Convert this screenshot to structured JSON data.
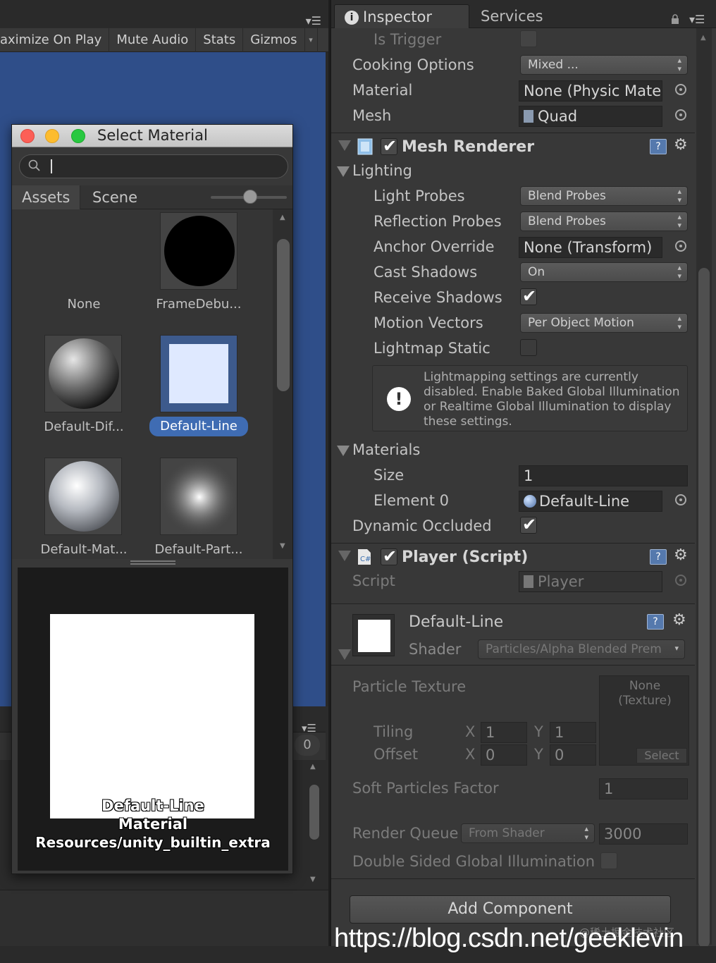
{
  "game_toolbar": {
    "buttons": [
      "aximize On Play",
      "Mute Audio",
      "Stats",
      "Gizmos"
    ]
  },
  "select_material": {
    "title": "Select Material",
    "search_value": "",
    "tabs": [
      "Assets",
      "Scene"
    ],
    "items": [
      {
        "label": "None",
        "icon": "none"
      },
      {
        "label": "FrameDebu...",
        "icon": "black-circle"
      },
      {
        "label": "Default-Dif...",
        "icon": "grey-sphere"
      },
      {
        "label": "Default-Line",
        "icon": "light-square",
        "selected": true
      },
      {
        "label": "Default-Mat...",
        "icon": "shiny-sphere"
      },
      {
        "label": "Default-Part...",
        "icon": "soft-glow"
      }
    ],
    "preview": {
      "name": "Default-Line",
      "type": "Material",
      "path": "Resources/unity_builtin_extra"
    }
  },
  "lower_panel": {
    "count": "0"
  },
  "inspector": {
    "tabs": [
      "Inspector",
      "Services"
    ],
    "collider": {
      "is_trigger": {
        "label": "Is Trigger",
        "checked": false
      },
      "cooking_options": {
        "label": "Cooking Options",
        "value": "Mixed ..."
      },
      "material": {
        "label": "Material",
        "value": "None (Physic Mate"
      },
      "mesh": {
        "label": "Mesh",
        "value": "Quad"
      }
    },
    "mesh_renderer": {
      "title": "Mesh Renderer",
      "enabled": true,
      "lighting_label": "Lighting",
      "light_probes": {
        "label": "Light Probes",
        "value": "Blend Probes"
      },
      "reflection_probes": {
        "label": "Reflection Probes",
        "value": "Blend Probes"
      },
      "anchor_override": {
        "label": "Anchor Override",
        "value": "None (Transform)"
      },
      "cast_shadows": {
        "label": "Cast Shadows",
        "value": "On"
      },
      "receive_shadows": {
        "label": "Receive Shadows",
        "checked": true
      },
      "motion_vectors": {
        "label": "Motion Vectors",
        "value": "Per Object Motion"
      },
      "lightmap_static": {
        "label": "Lightmap Static",
        "checked": false
      },
      "info": "Lightmapping settings are currently disabled. Enable Baked Global Illumination or Realtime Global Illumination to display these settings.",
      "materials_label": "Materials",
      "size": {
        "label": "Size",
        "value": "1"
      },
      "element0": {
        "label": "Element 0",
        "value": "Default-Line"
      },
      "dynamic_occluded": {
        "label": "Dynamic Occluded",
        "checked": true
      }
    },
    "player_script": {
      "title": "Player (Script)",
      "enabled": true,
      "script": {
        "label": "Script",
        "value": "Player"
      }
    },
    "material": {
      "name": "Default-Line",
      "shader_label": "Shader",
      "shader_value": "Particles/Alpha Blended Prem",
      "particle_texture": {
        "label": "Particle Texture",
        "slot_line1": "None",
        "slot_line2": "(Texture)",
        "select_label": "Select"
      },
      "tiling": {
        "label": "Tiling",
        "x": "1",
        "y": "1"
      },
      "offset": {
        "label": "Offset",
        "x": "0",
        "y": "0"
      },
      "axis_x": "X",
      "axis_y": "Y",
      "soft_particles": {
        "label": "Soft Particles Factor",
        "value": "1"
      },
      "render_queue": {
        "label": "Render Queue",
        "mode": "From Shader",
        "value": "3000"
      },
      "double_sided_gi": {
        "label": "Double Sided Global Illumination",
        "checked": false
      }
    },
    "add_component": "Add Component"
  },
  "watermark": {
    "url": "https://blog.csdn.net/geeklevin",
    "cn": "@稀土掘金技术社区"
  }
}
